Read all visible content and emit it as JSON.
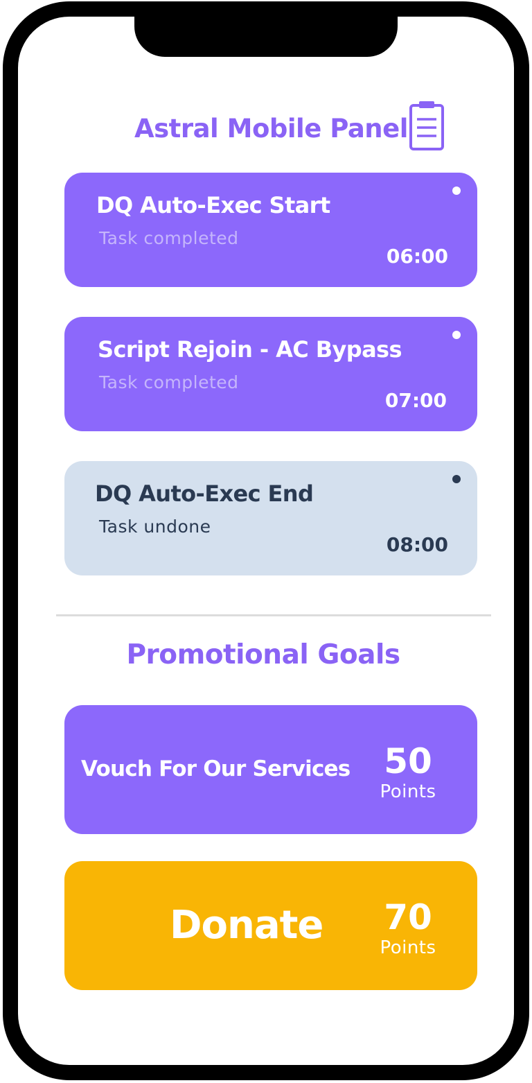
{
  "header": {
    "title": "Astral Mobile Panel",
    "icon": "clipboard-icon"
  },
  "tasks": [
    {
      "name": "DQ Auto-Exec Start",
      "status": "Task completed",
      "time": "06:00",
      "done": true
    },
    {
      "name": "Script Rejoin - AC Bypass",
      "status": "Task completed",
      "time": "07:00",
      "done": true
    },
    {
      "name": "DQ Auto-Exec End",
      "status": "Task undone",
      "time": "08:00",
      "done": false
    }
  ],
  "goals": {
    "title": "Promotional Goals",
    "items": [
      {
        "label": "Vouch For Our Services",
        "points": "50",
        "unit": "Points"
      },
      {
        "label": "Donate",
        "points": "70",
        "unit": "Points"
      }
    ]
  },
  "colors": {
    "accent": "#8a63f5",
    "card_done": "#8c68fb",
    "card_undone": "#d4e0ee",
    "donate": "#f9b505",
    "dark_text": "#2a3a52"
  }
}
